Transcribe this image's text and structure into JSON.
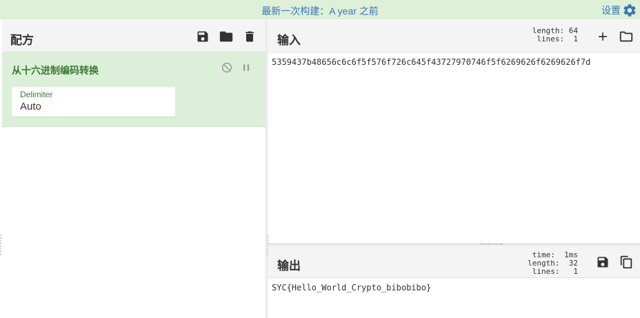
{
  "topbar": {
    "banner": "最新一次构建：A year 之前",
    "settings_label": "设置"
  },
  "recipe": {
    "title": "配方",
    "operation": {
      "name": "从十六进制编码转换",
      "field_label": "Delimiter",
      "field_value": "Auto"
    }
  },
  "input": {
    "title": "输入",
    "stats_length": "length: 64",
    "stats_lines": " lines:  1",
    "text": "5359437b48656c6c6f5f576f726c645f43727970746f5f6269626f6269626f7d"
  },
  "output": {
    "title": "输出",
    "stats_time": "  time:  1ms",
    "stats_length": "length:  32",
    "stats_lines": " lines:   1",
    "text": "SYC{Hello_World_Crypto_bibobibo}"
  },
  "colors": {
    "banner_bg": "#dff0d8",
    "op_bg": "#dcefd8",
    "accent_blue": "#3a76b8",
    "op_green": "#3c7a34"
  }
}
